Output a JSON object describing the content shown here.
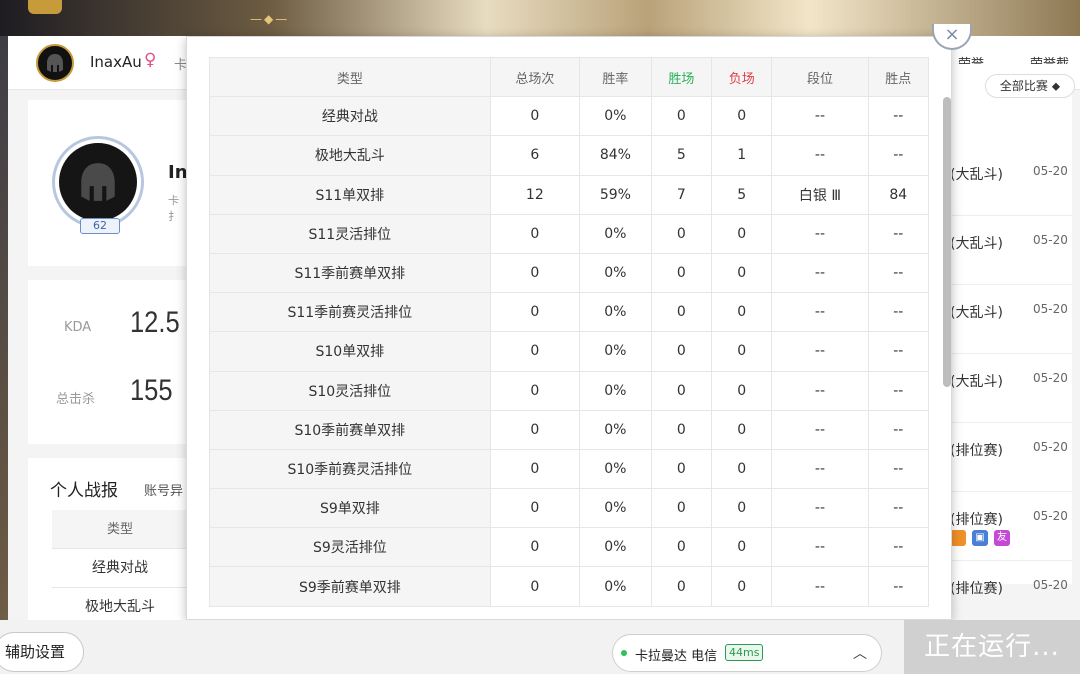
{
  "top": {
    "username": "InaxAu",
    "gender_symbol": "♀",
    "sep_text": "卡",
    "nav": [
      "荣誉",
      "荣誉截图"
    ]
  },
  "profile": {
    "name_partial": "In",
    "sub_partial": "卡扌",
    "level": "62"
  },
  "stats": {
    "kda_label": "KDA",
    "kda_value": "12.5",
    "kills_label": "总击杀",
    "kills_value": "155"
  },
  "record": {
    "title": "个人战报",
    "filter_partial": "账号异",
    "header": "类型",
    "rows": [
      "经典对战",
      "极地大乱斗"
    ]
  },
  "matches": {
    "filter": "全部比赛 ⬥",
    "rows": [
      {
        "type": "(大乱斗)",
        "date": "05-20"
      },
      {
        "type": "(大乱斗)",
        "date": "05-20"
      },
      {
        "type": "(大乱斗)",
        "date": "05-20"
      },
      {
        "type": "(大乱斗)",
        "date": "05-20"
      },
      {
        "type": "(排位赛)",
        "date": "05-20"
      },
      {
        "type": "(排位赛)",
        "date": "05-20"
      },
      {
        "type": "(排位赛)",
        "date": "05-20"
      }
    ],
    "tag_labels": [
      "友"
    ]
  },
  "popup": {
    "close_icon": "×",
    "headers": [
      "类型",
      "总场次",
      "胜率",
      "胜场",
      "负场",
      "段位",
      "胜点"
    ],
    "rows": [
      [
        "经典对战",
        "0",
        "0%",
        "0",
        "0",
        "--",
        "--"
      ],
      [
        "极地大乱斗",
        "6",
        "84%",
        "5",
        "1",
        "--",
        "--"
      ],
      [
        "S11单双排",
        "12",
        "59%",
        "7",
        "5",
        "白银 Ⅲ",
        "84"
      ],
      [
        "S11灵活排位",
        "0",
        "0%",
        "0",
        "0",
        "--",
        "--"
      ],
      [
        "S11季前赛单双排",
        "0",
        "0%",
        "0",
        "0",
        "--",
        "--"
      ],
      [
        "S11季前赛灵活排位",
        "0",
        "0%",
        "0",
        "0",
        "--",
        "--"
      ],
      [
        "S10单双排",
        "0",
        "0%",
        "0",
        "0",
        "--",
        "--"
      ],
      [
        "S10灵活排位",
        "0",
        "0%",
        "0",
        "0",
        "--",
        "--"
      ],
      [
        "S10季前赛单双排",
        "0",
        "0%",
        "0",
        "0",
        "--",
        "--"
      ],
      [
        "S10季前赛灵活排位",
        "0",
        "0%",
        "0",
        "0",
        "--",
        "--"
      ],
      [
        "S9单双排",
        "0",
        "0%",
        "0",
        "0",
        "--",
        "--"
      ],
      [
        "S9灵活排位",
        "0",
        "0%",
        "0",
        "0",
        "--",
        "--"
      ],
      [
        "S9季前赛单双排",
        "0",
        "0%",
        "0",
        "0",
        "--",
        "--"
      ]
    ]
  },
  "bottom": {
    "assist": "辅助设置",
    "server": "卡拉曼达 电信",
    "ping": "44ms",
    "chevron": "︿",
    "run": "正在运行..."
  },
  "colors": {
    "win": "#2bb05a",
    "lose": "#e0404a",
    "ping_green": "#2b9a4a"
  }
}
